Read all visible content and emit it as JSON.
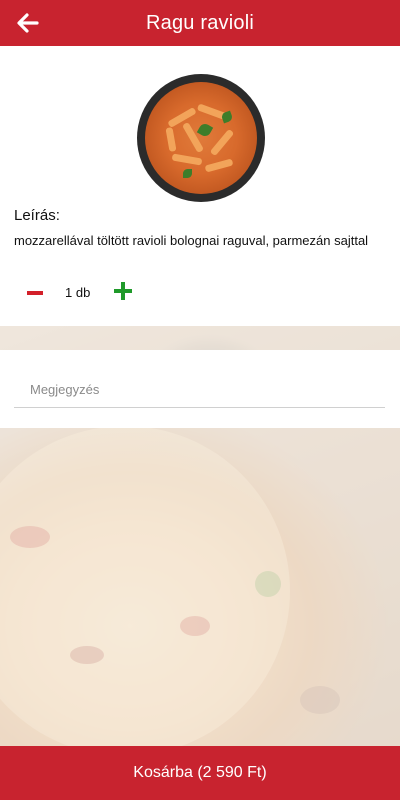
{
  "header": {
    "title": "Ragu ravioli",
    "back_icon": "arrow-left-icon"
  },
  "product": {
    "image_icon": "pasta-dish-image",
    "description_label": "Leírás:",
    "description_text": "mozzarellával töltött ravioli bolognai raguval, parmezán sajttal",
    "quantity": "1 db"
  },
  "note": {
    "placeholder": "Megjegyzés",
    "value": ""
  },
  "cart": {
    "button_label": "Kosárba (2 590 Ft)"
  },
  "colors": {
    "brand": "#c8232f",
    "minus": "#d3202a",
    "plus": "#1f9a2a"
  }
}
